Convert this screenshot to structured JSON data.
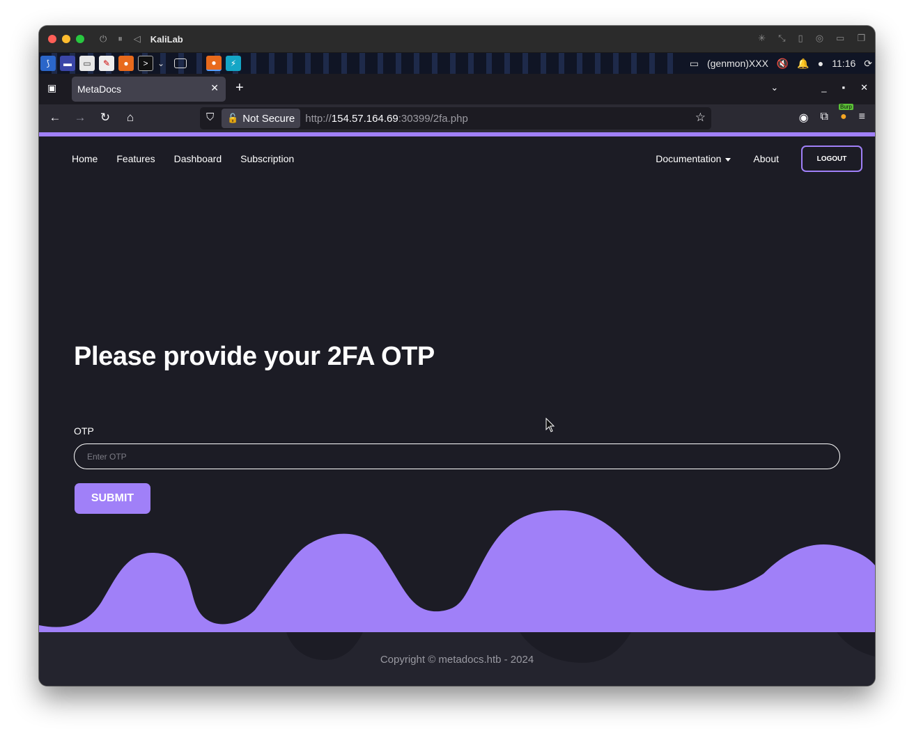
{
  "mac": {
    "title": "KaliLab",
    "controls": [
      "power-icon",
      "pause-icon",
      "back-icon"
    ]
  },
  "kali_panel": {
    "genmon_text": "(genmon)XXX",
    "clock": "11:16",
    "burp_label": "Burp"
  },
  "browser": {
    "tab_title": "MetaDocs",
    "security_label": "Not Secure",
    "url_scheme": "http://",
    "url_host": "154.57.164.69",
    "url_rest": ":30399/2fa.php"
  },
  "site": {
    "nav_left": [
      "Home",
      "Features",
      "Dashboard",
      "Subscription"
    ],
    "nav_documentation": "Documentation",
    "nav_about": "About",
    "logout_label": "LOGOUT",
    "headline": "Please provide your 2FA OTP",
    "otp_label": "OTP",
    "otp_placeholder": "Enter OTP",
    "otp_value": "",
    "submit_label": "SUBMIT",
    "copyright": "Copyright © metadocs.htb - 2024"
  },
  "colors": {
    "accent": "#a080f8",
    "page_bg": "#1c1c25",
    "footer_bg": "#24242e"
  }
}
